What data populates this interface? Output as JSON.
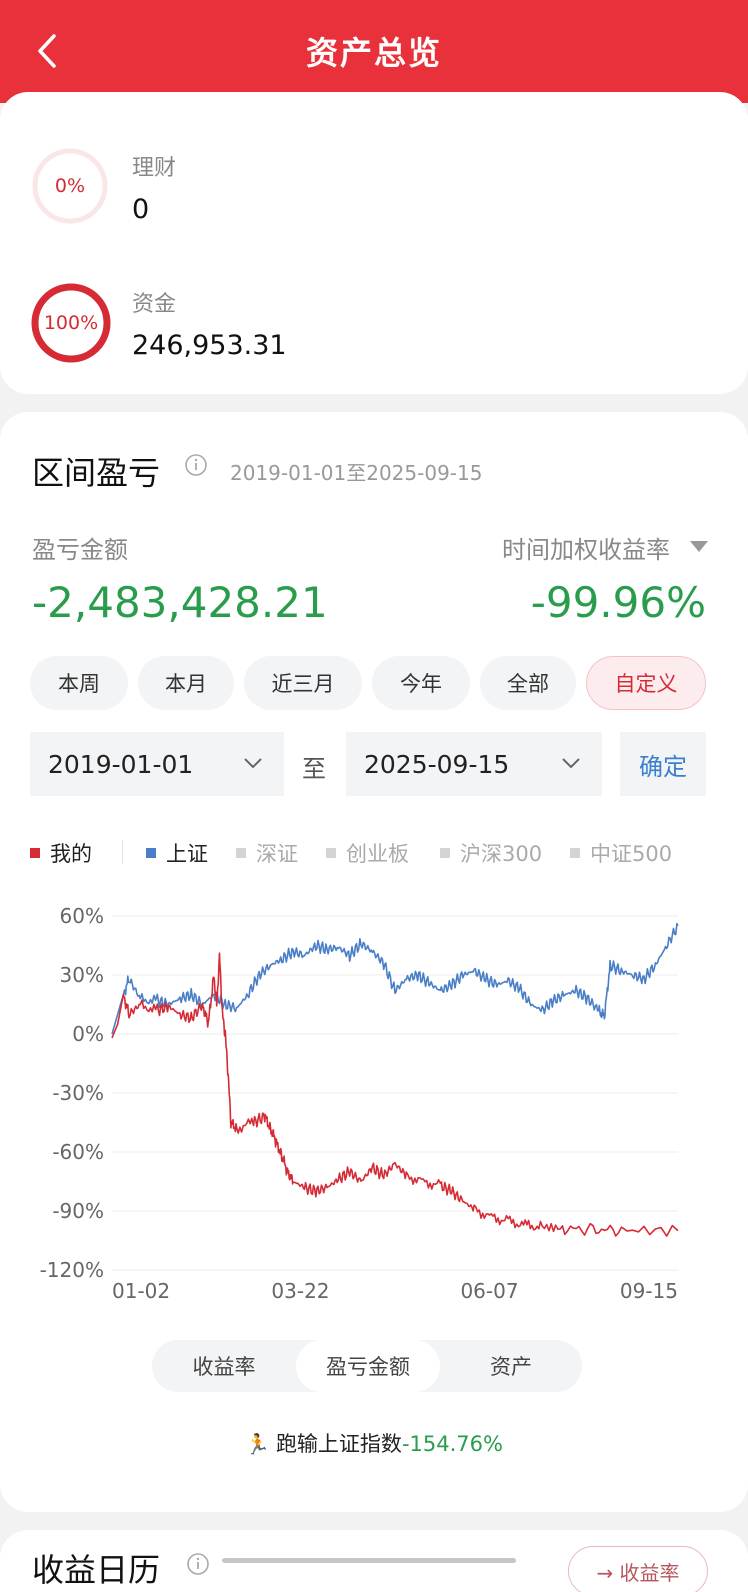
{
  "header": {
    "title": "资产总览"
  },
  "assets": [
    {
      "name": "理财",
      "value": "0",
      "pct_label": "0%",
      "fraction": 0.0
    },
    {
      "name": "资金",
      "value": "246,953.31",
      "pct_label": "100%",
      "fraction": 1.0
    }
  ],
  "section": {
    "title": "区间盈亏",
    "range": "2019-01-01至2025-09-15",
    "pl_label": "盈亏金额",
    "pl_value": "-2,483,428.21",
    "twr_label": "时间加权收益率",
    "twr_value": "-99.96%"
  },
  "periods": [
    {
      "label": "本周",
      "active": false
    },
    {
      "label": "本月",
      "active": false
    },
    {
      "label": "近三月",
      "active": false
    },
    {
      "label": "今年",
      "active": false
    },
    {
      "label": "全部",
      "active": false
    },
    {
      "label": "自定义",
      "active": true
    }
  ],
  "date_range": {
    "start": "2019-01-01",
    "to": "至",
    "end": "2025-09-15",
    "confirm": "确定"
  },
  "legend": [
    {
      "label": "我的",
      "color": "#d62b35",
      "active": true
    },
    {
      "label": "上证",
      "color": "#4a7fc7",
      "active": true
    },
    {
      "label": "深证",
      "color": "#cccccc",
      "active": false
    },
    {
      "label": "创业板",
      "color": "#cccccc",
      "active": false
    },
    {
      "label": "沪深300",
      "color": "#cccccc",
      "active": false
    },
    {
      "label": "中证500",
      "color": "#cccccc",
      "active": false
    }
  ],
  "chart_data": {
    "type": "line",
    "y_ticks": [
      "60%",
      "30%",
      "0%",
      "-30%",
      "-60%",
      "-90%",
      "-120%"
    ],
    "ylim": [
      -120,
      60
    ],
    "x_ticks": [
      "01-02",
      "03-22",
      "06-07",
      "09-15"
    ],
    "x_tick_positions": [
      0.0,
      0.333,
      0.667,
      1.0
    ],
    "series": [
      {
        "name": "我的",
        "color": "#d62b35",
        "points": [
          [
            0,
            -2
          ],
          [
            0.01,
            5
          ],
          [
            0.02,
            20
          ],
          [
            0.03,
            10
          ],
          [
            0.05,
            15
          ],
          [
            0.08,
            12
          ],
          [
            0.1,
            14
          ],
          [
            0.12,
            10
          ],
          [
            0.14,
            8
          ],
          [
            0.16,
            15
          ],
          [
            0.17,
            5
          ],
          [
            0.18,
            30
          ],
          [
            0.185,
            15
          ],
          [
            0.19,
            40
          ],
          [
            0.195,
            10
          ],
          [
            0.2,
            0
          ],
          [
            0.205,
            -20
          ],
          [
            0.21,
            -45
          ],
          [
            0.22,
            -48
          ],
          [
            0.25,
            -45
          ],
          [
            0.27,
            -42
          ],
          [
            0.28,
            -48
          ],
          [
            0.29,
            -55
          ],
          [
            0.3,
            -62
          ],
          [
            0.31,
            -70
          ],
          [
            0.32,
            -75
          ],
          [
            0.34,
            -78
          ],
          [
            0.36,
            -80
          ],
          [
            0.38,
            -78
          ],
          [
            0.4,
            -74
          ],
          [
            0.42,
            -70
          ],
          [
            0.44,
            -75
          ],
          [
            0.46,
            -68
          ],
          [
            0.48,
            -72
          ],
          [
            0.5,
            -66
          ],
          [
            0.52,
            -72
          ],
          [
            0.55,
            -75
          ],
          [
            0.58,
            -77
          ],
          [
            0.6,
            -80
          ],
          [
            0.62,
            -85
          ],
          [
            0.64,
            -89
          ],
          [
            0.67,
            -93
          ],
          [
            0.7,
            -95
          ],
          [
            0.73,
            -97
          ],
          [
            0.76,
            -98
          ],
          [
            0.8,
            -99
          ],
          [
            0.85,
            -99.5
          ],
          [
            0.9,
            -99.7
          ],
          [
            1.0,
            -99.96
          ]
        ]
      },
      {
        "name": "上证",
        "color": "#4a7fc7",
        "points": [
          [
            0,
            0
          ],
          [
            0.01,
            10
          ],
          [
            0.02,
            20
          ],
          [
            0.03,
            28
          ],
          [
            0.05,
            18
          ],
          [
            0.08,
            17
          ],
          [
            0.1,
            15
          ],
          [
            0.12,
            18
          ],
          [
            0.14,
            20
          ],
          [
            0.16,
            15
          ],
          [
            0.18,
            20
          ],
          [
            0.2,
            15
          ],
          [
            0.22,
            13
          ],
          [
            0.24,
            20
          ],
          [
            0.26,
            30
          ],
          [
            0.28,
            35
          ],
          [
            0.3,
            38
          ],
          [
            0.32,
            42
          ],
          [
            0.34,
            40
          ],
          [
            0.36,
            45
          ],
          [
            0.38,
            43
          ],
          [
            0.4,
            44
          ],
          [
            0.42,
            40
          ],
          [
            0.44,
            46
          ],
          [
            0.46,
            42
          ],
          [
            0.48,
            36
          ],
          [
            0.5,
            22
          ],
          [
            0.52,
            28
          ],
          [
            0.54,
            30
          ],
          [
            0.56,
            26
          ],
          [
            0.58,
            22
          ],
          [
            0.6,
            25
          ],
          [
            0.62,
            30
          ],
          [
            0.64,
            32
          ],
          [
            0.66,
            28
          ],
          [
            0.68,
            25
          ],
          [
            0.7,
            27
          ],
          [
            0.72,
            23
          ],
          [
            0.74,
            15
          ],
          [
            0.76,
            12
          ],
          [
            0.78,
            17
          ],
          [
            0.8,
            20
          ],
          [
            0.82,
            22
          ],
          [
            0.84,
            18
          ],
          [
            0.86,
            12
          ],
          [
            0.87,
            9
          ],
          [
            0.88,
            35
          ],
          [
            0.9,
            32
          ],
          [
            0.92,
            30
          ],
          [
            0.94,
            28
          ],
          [
            0.96,
            35
          ],
          [
            0.98,
            45
          ],
          [
            1.0,
            55
          ]
        ]
      }
    ]
  },
  "view_tabs": [
    {
      "label": "收益率",
      "active": true
    },
    {
      "label": "盈亏金额",
      "active": false
    },
    {
      "label": "资产",
      "active": false
    }
  ],
  "summary": {
    "text": "跑输上证指数",
    "value": "-154.76%"
  },
  "calendar": {
    "title": "收益日历",
    "link": "→ 收益率"
  }
}
